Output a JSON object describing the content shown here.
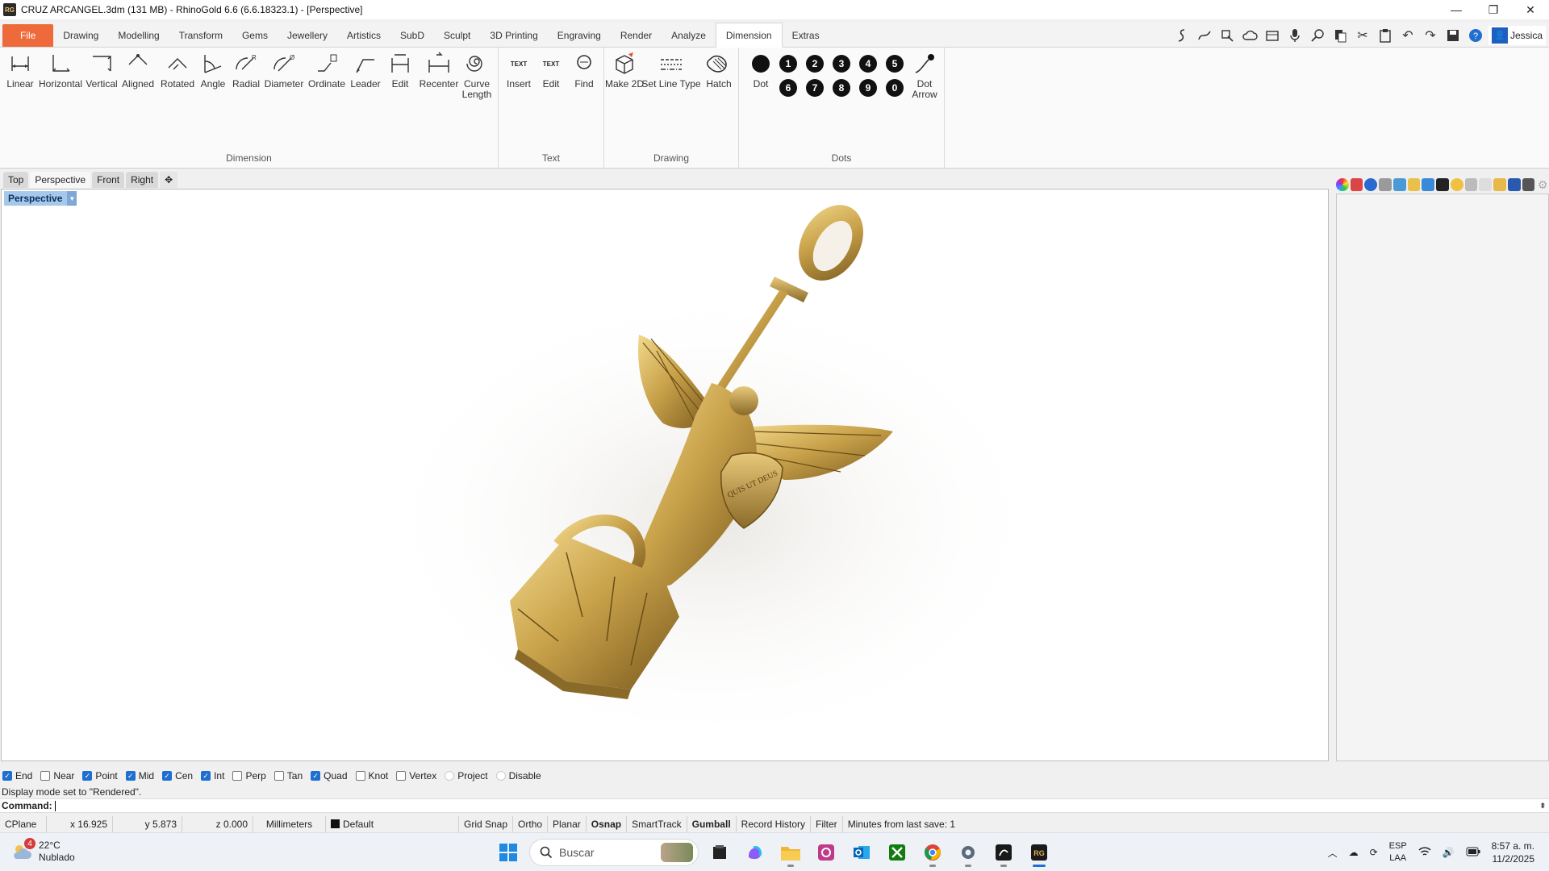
{
  "window": {
    "title": "CRUZ ARCANGEL.3dm (131 MB) - RhinoGold 6.6 (6.6.18323.1) - [Perspective]",
    "logo_text": "RG",
    "minimize": "—",
    "restore": "❐",
    "close": "✕"
  },
  "ribbon_tabs": [
    "File",
    "Drawing",
    "Modelling",
    "Transform",
    "Gems",
    "Jewellery",
    "Artistics",
    "SubD",
    "Sculpt",
    "3D Printing",
    "Engraving",
    "Render",
    "Analyze",
    "Dimension",
    "Extras"
  ],
  "active_ribbon_tab": "Dimension",
  "user": {
    "name": "Jessica"
  },
  "ribbon_groups": {
    "dimension": {
      "label": "Dimension",
      "buttons": [
        "Linear",
        "Horizontal",
        "Vertical",
        "Aligned",
        "Rotated",
        "Angle",
        "Radial",
        "Diameter",
        "Ordinate",
        "Leader",
        "Edit",
        "Recenter",
        "Curve Length"
      ]
    },
    "text": {
      "label": "Text",
      "buttons": [
        "Insert",
        "Edit",
        "Find"
      ],
      "icon_text": "TEXT"
    },
    "drawing": {
      "label": "Drawing",
      "buttons": [
        "Make 2D",
        "Set Line Type",
        "Hatch"
      ]
    },
    "dots": {
      "label": "Dots",
      "dot_label": "Dot",
      "dot_arrow_label": "Dot Arrow",
      "numbers_row1": [
        "1",
        "2",
        "3",
        "4",
        "5"
      ],
      "numbers_row2": [
        "6",
        "7",
        "8",
        "9",
        "0"
      ]
    }
  },
  "viewport_tabs": [
    "Top",
    "Perspective",
    "Front",
    "Right"
  ],
  "active_viewport_tab": "Perspective",
  "viewport": {
    "label": "Perspective",
    "display_mode": "Rendered",
    "engraving_text": "QUIS UT DEUS"
  },
  "osnaps": [
    {
      "label": "End",
      "checked": true
    },
    {
      "label": "Near",
      "checked": false
    },
    {
      "label": "Point",
      "checked": true
    },
    {
      "label": "Mid",
      "checked": true
    },
    {
      "label": "Cen",
      "checked": true
    },
    {
      "label": "Int",
      "checked": true
    },
    {
      "label": "Perp",
      "checked": false
    },
    {
      "label": "Tan",
      "checked": false
    },
    {
      "label": "Quad",
      "checked": true
    },
    {
      "label": "Knot",
      "checked": false
    },
    {
      "label": "Vertex",
      "checked": false
    },
    {
      "label": "Project",
      "checked": false,
      "disabled": true
    },
    {
      "label": "Disable",
      "checked": false,
      "disabled": true
    }
  ],
  "command": {
    "history": "Display mode set to \"Rendered\".",
    "prompt": "Command:"
  },
  "status_bar": {
    "cplane": "CPlane",
    "x": "x 16.925",
    "y": "y 5.873",
    "z": "z 0.000",
    "units": "Millimeters",
    "layer": "Default",
    "toggles": [
      "Grid Snap",
      "Ortho",
      "Planar",
      "Osnap",
      "SmartTrack",
      "Gumball",
      "Record History",
      "Filter"
    ],
    "bold_toggles": [
      "Osnap",
      "Gumball"
    ],
    "save_info": "Minutes from last save: 1"
  },
  "taskbar": {
    "weather": {
      "temp": "22°C",
      "condition": "Nublado",
      "badge": "4"
    },
    "search_placeholder": "Buscar",
    "apps": [
      "start-icon",
      "file-manager-icon",
      "copilot-icon",
      "folder-icon",
      "camera-app-icon",
      "outlook-icon",
      "xbox-icon",
      "chrome-icon",
      "settings-icon",
      "rhino-icon",
      "rhinogold-icon"
    ],
    "language": {
      "line1": "ESP",
      "line2": "LAA"
    },
    "clock": {
      "time": "8:57 a. m.",
      "date": "11/2/2025"
    }
  },
  "colors": {
    "file_tab": "#ef6a3a",
    "viewport_label_bg": "#a6c8ea",
    "checkbox_on": "#1f6fd0",
    "gold": "#c9a24a"
  }
}
